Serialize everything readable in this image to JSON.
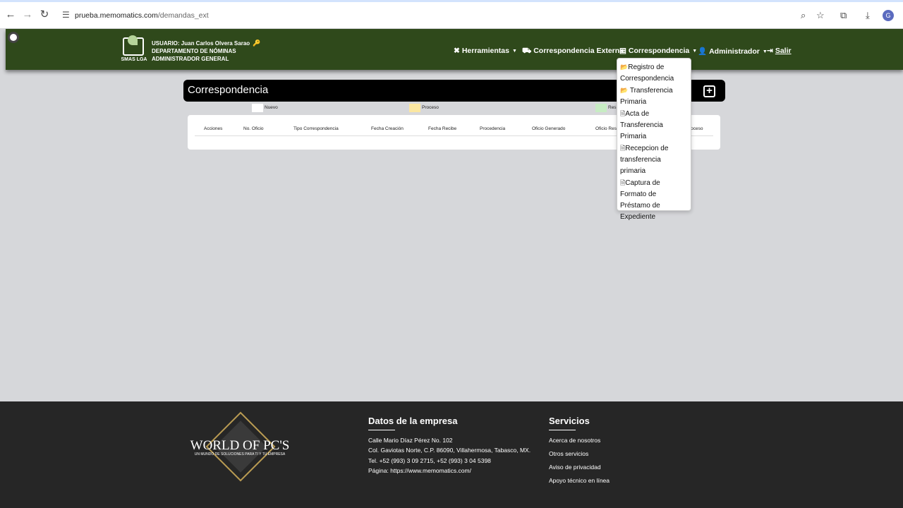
{
  "browser": {
    "url_domain": "prueba.memomatics.com",
    "url_path": "/demandas_ext",
    "avatar_letter": "G"
  },
  "header": {
    "logo_text": "SMAS LGA",
    "user_line": "USUARIO: Juan Carlos Olvera Sarao",
    "dept_line": "DEPARTAMENTO DE NÓMINAS",
    "role_line": "ADMINISTRADOR GENERAL",
    "menu": {
      "herramientas": "Herramientas",
      "correspondencia_externa": "Correspondencia Externa",
      "correspondencia": "Correspondencia",
      "administrador": "Administrador",
      "salir": "Salir"
    }
  },
  "dropdown": {
    "items": [
      "Registro de Correspondencia",
      "Transferencia Primaria",
      "Acta de Transferencia Primaria",
      "Recepcion de transferencia primaria",
      "Captura de Formato de Préstamo de Expediente"
    ]
  },
  "page": {
    "title": "Correspondencia",
    "legend": {
      "nuevo": "Nuevo",
      "proceso": "Proceso",
      "resuelto_partial": "Res"
    },
    "legend_colors": {
      "nuevo": "#ffffff",
      "proceso": "#fbe7a1",
      "resuelto": "#c7ecc3"
    },
    "table_headers": [
      "Acciones",
      "No. Oficio",
      "Tipo Correspondencia",
      "Fecha Creación",
      "Fecha Recibe",
      "Procedencia",
      "Oficio Generado",
      "Oficio Res",
      "roceso"
    ]
  },
  "footer": {
    "logo_text": "WORLD OF PC'S",
    "logo_sub": "UN MUNDO DE SOLUCIONES PARA TI Y TU EMPRESA",
    "company_title": "Datos de la empresa",
    "company_lines": [
      "Calle Mario Díaz Pérez No. 102",
      "Col. Gaviotas Norte, C.P. 86090, Villahermosa, Tabasco, MX.",
      "Tel. +52 (993) 3 09 2715, +52 (993) 3 04 5398",
      "Página: https://www.memomatics.com/"
    ],
    "services_title": "Servicios",
    "services": [
      "Acerca de nosotros",
      "Otros servicios",
      "Aviso de privacidad",
      "Apoyo técnico en línea"
    ]
  },
  "colors": {
    "header_bg": "#2f491b",
    "page_bg": "#d6d7da",
    "footer_bg": "#262626"
  }
}
